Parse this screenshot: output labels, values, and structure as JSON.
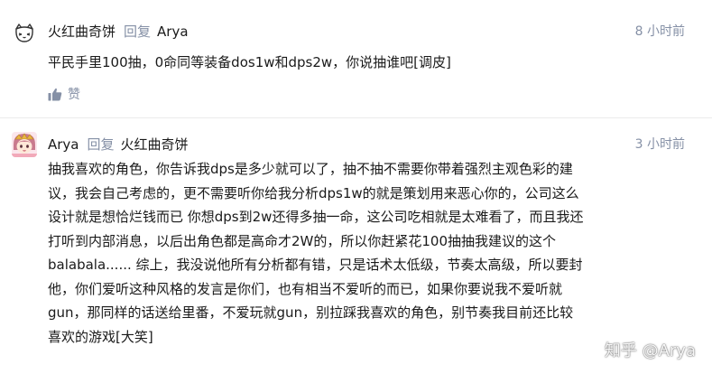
{
  "comments": [
    {
      "author": "火红曲奇饼",
      "reply_word": "回复",
      "reply_to": "Arya",
      "time": "8 小时前",
      "lines": [
        "平民手里100抽，0命同等装备dos1w和dps2w，你说抽谁吧[调皮]"
      ],
      "like_label": "赞"
    },
    {
      "author": "Arya",
      "reply_word": "回复",
      "reply_to": "火红曲奇饼",
      "time": "3 小时前",
      "lines": [
        "抽我喜欢的角色，你告诉我dps是多少就可以了，抽不抽不需要你带着强烈主观色彩的建",
        "议，我会自己考虑的，更不需要听你给我分析dps1w的就是策划用来恶心你的，公司这么",
        "设计就是想恰烂钱而已 你想dps到2w还得多抽一命，这公司吃相就是太难看了，而且我还",
        "打听到内部消息，以后出角色都是高命才2W的，所以你赶紧花100抽抽我建议的这个",
        "balabala...... 综上，我没说他所有分析都有错，只是话术太低级，节奏太高级，所以要封",
        "他，你们爱听这种风格的发言是你们，也有相当不爱听的而已，如果你要说我不爱听就",
        "gun，那同样的话送给里番，不爱玩就gun，别拉踩我喜欢的角色，别节奏我目前还比较",
        "喜欢的游戏[大笑]"
      ]
    }
  ],
  "watermark": "知乎 @Arya",
  "colors": {
    "meta": "#8590a6",
    "text": "#1a1a1a",
    "divider": "#ebebeb"
  },
  "icons": {
    "like": "thumbs-up-icon"
  }
}
